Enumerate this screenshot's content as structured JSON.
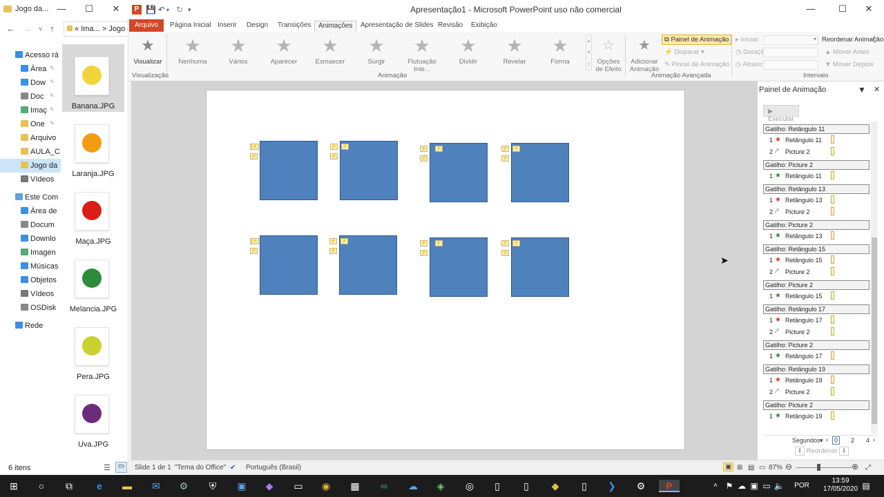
{
  "explorer": {
    "title": "Jogo da...",
    "address": [
      "«",
      "Ima...",
      ">",
      "Jogo da"
    ],
    "tree": [
      {
        "label": "Acesso rá",
        "icon": "star-icon",
        "indent": 0
      },
      {
        "label": "Área",
        "icon": "desktop-icon",
        "indent": 1,
        "pin": true
      },
      {
        "label": "Dow",
        "icon": "download-icon",
        "indent": 1,
        "pin": true
      },
      {
        "label": "Doc",
        "icon": "document-icon",
        "indent": 1,
        "pin": true
      },
      {
        "label": "Imaç",
        "icon": "picture-icon",
        "indent": 1,
        "pin": true
      },
      {
        "label": "One",
        "icon": "folder-icon",
        "indent": 1,
        "pin": true
      },
      {
        "label": "Arquivo",
        "icon": "folder-icon",
        "indent": 1
      },
      {
        "label": "AULA_C",
        "icon": "folder-icon",
        "indent": 1
      },
      {
        "label": "Jogo da",
        "icon": "folder-icon",
        "indent": 1,
        "selected": true
      },
      {
        "label": "Vídeos",
        "icon": "video-icon",
        "indent": 1
      },
      {
        "label": "Este Com",
        "icon": "computer-icon",
        "indent": 0
      },
      {
        "label": "Área de",
        "icon": "desktop-icon",
        "indent": 1
      },
      {
        "label": "Docum",
        "icon": "document-icon",
        "indent": 1
      },
      {
        "label": "Downlo",
        "icon": "download-icon",
        "indent": 1
      },
      {
        "label": "Imagen",
        "icon": "picture-icon",
        "indent": 1
      },
      {
        "label": "Músicas",
        "icon": "music-icon",
        "indent": 1
      },
      {
        "label": "Objetos",
        "icon": "cube-icon",
        "indent": 1
      },
      {
        "label": "Vídeos",
        "icon": "video-icon",
        "indent": 1
      },
      {
        "label": "OSDisk",
        "icon": "disk-icon",
        "indent": 1
      },
      {
        "label": "Rede",
        "icon": "network-icon",
        "indent": 0
      }
    ],
    "files": [
      {
        "name": "Banana.JPG",
        "icon": "banana-icon",
        "color": "#f2d43a",
        "selected": true
      },
      {
        "name": "Laranja.JPG",
        "icon": "orange-icon",
        "color": "#f39c12"
      },
      {
        "name": "Maça.JPG",
        "icon": "apple-icon",
        "color": "#d91e18"
      },
      {
        "name": "Melancia.JPG",
        "icon": "watermelon-icon",
        "color": "#2e8b3a"
      },
      {
        "name": "Pera.JPG",
        "icon": "pear-icon",
        "color": "#c9d12e"
      },
      {
        "name": "Uva.JPG",
        "icon": "grape-icon",
        "color": "#6b2d7a"
      }
    ],
    "status": "6 itens"
  },
  "ppt": {
    "title": "Apresentação1 - Microsoft PowerPoint uso não comercial",
    "tabs": [
      "Arquivo",
      "Página Inicial",
      "Inserir",
      "Design",
      "Transições",
      "Animações",
      "Apresentação de Slides",
      "Revisão",
      "Exibição"
    ],
    "active_tab": "Animações",
    "ribbon": {
      "preview": "Visualizar",
      "effects": [
        "Nenhuma",
        "Vários",
        "Aparecer",
        "Esmaecer",
        "Surgir",
        "Flutuação Inte...",
        "Dividir",
        "Revelar",
        "Forma"
      ],
      "effect_options": [
        "Opções",
        "de Efeito"
      ],
      "add_animation": [
        "Adicionar",
        "Animação"
      ],
      "anim_pane_btn": "Painel de Animação",
      "trigger": "Disparar",
      "painter": "Pincel de Animação",
      "start": "Iniciar:",
      "duration": "Duração:",
      "delay": "Atraso:",
      "reorder": "Reordenar Animação",
      "move_earlier": "Mover Antes",
      "move_later": "Mover Depois",
      "groups": [
        "Visualização",
        "Animação",
        "Animação Avançada",
        "Intervalo"
      ]
    },
    "pane": {
      "title": "Painel de Animação",
      "play": "Executar",
      "entries": [
        {
          "trigger": "Gatilho: Retângulo 11",
          "items": [
            {
              "n": "1",
              "type": "exit",
              "label": "Retângulo 11"
            },
            {
              "n": "2",
              "type": "motion",
              "label": "Picture 2"
            }
          ]
        },
        {
          "trigger": "Gatilho: Picture 2",
          "items": [
            {
              "n": "1",
              "type": "entrance",
              "label": "Retângulo 11"
            }
          ]
        },
        {
          "trigger": "Gatilho: Retângulo 13",
          "items": [
            {
              "n": "1",
              "type": "exit",
              "label": "Retângulo 13"
            },
            {
              "n": "2",
              "type": "motion",
              "label": "Picture 2"
            }
          ]
        },
        {
          "trigger": "Gatilho: Picture 2",
          "items": [
            {
              "n": "1",
              "type": "entrance",
              "label": "Retângulo 13"
            }
          ]
        },
        {
          "trigger": "Gatilho: Retângulo 15",
          "items": [
            {
              "n": "1",
              "type": "exit",
              "label": "Retângulo 15"
            },
            {
              "n": "2",
              "type": "motion",
              "label": "Picture 2"
            }
          ]
        },
        {
          "trigger": "Gatilho: Picture 2",
          "items": [
            {
              "n": "1",
              "type": "entrance",
              "label": "Retângulo 15"
            }
          ]
        },
        {
          "trigger": "Gatilho: Retângulo 17",
          "items": [
            {
              "n": "1",
              "type": "exit",
              "label": "Retângulo 17"
            },
            {
              "n": "2",
              "type": "motion",
              "label": "Picture 2"
            }
          ]
        },
        {
          "trigger": "Gatilho: Picture 2",
          "items": [
            {
              "n": "1",
              "type": "entrance",
              "label": "Retângulo 17"
            }
          ]
        },
        {
          "trigger": "Gatilho: Retângulo 19",
          "items": [
            {
              "n": "1",
              "type": "exit",
              "label": "Retângulo 19"
            },
            {
              "n": "2",
              "type": "motion",
              "label": "Picture 2"
            }
          ]
        },
        {
          "trigger": "Gatilho: Picture 2",
          "items": [
            {
              "n": "1",
              "type": "entrance",
              "label": "Retângulo 19"
            }
          ]
        }
      ],
      "timeline": {
        "label": "Segundos",
        "ticks": [
          "0",
          "2",
          "4"
        ]
      },
      "reorder": "Reordenar"
    },
    "status": {
      "slide": "Slide 1 de 1",
      "theme": "\"Tema do Office\"",
      "lang": "Português (Brasil)",
      "zoom": "87%"
    },
    "accent": "#d24726",
    "shape_color": "#4f81bd"
  },
  "taskbar": {
    "lang": "POR",
    "time": "13:59",
    "date": "17/05/2020"
  }
}
